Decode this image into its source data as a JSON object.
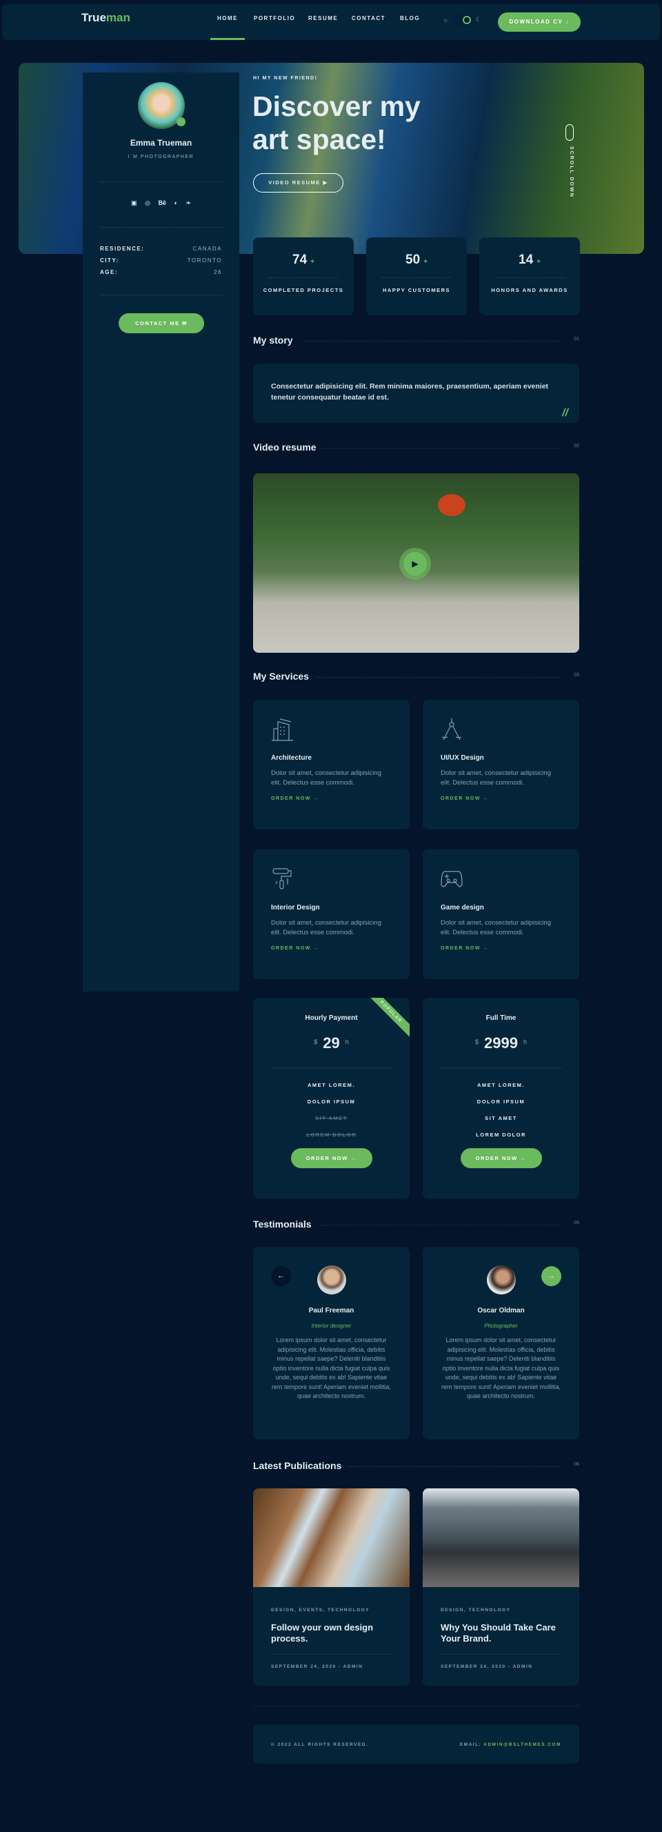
{
  "header": {
    "logo_a": "True",
    "logo_b": "man",
    "nav": [
      "Home",
      "Portfolio",
      "Resume",
      "Contact",
      "Blog"
    ],
    "download": "Download CV",
    "accent": "#6cba5e"
  },
  "hero": {
    "kicker": "Hi my new friend!",
    "title_1": "Discover my",
    "title_2": "art space!",
    "video_btn": "Video resume",
    "scroll": "Scroll down"
  },
  "profile": {
    "name": "Emma Trueman",
    "role": "I`m photographer",
    "social": [
      "linkedin-icon",
      "dribbble-icon",
      "behance-icon",
      "github-icon",
      "twitter-icon"
    ],
    "info": [
      {
        "k": "Residence:",
        "v": "Canada"
      },
      {
        "k": "City:",
        "v": "Toronto"
      },
      {
        "k": "Age:",
        "v": "26"
      }
    ],
    "contact": "Contact me"
  },
  "stats": [
    {
      "v": "74",
      "l": "Completed projects"
    },
    {
      "v": "50",
      "l": "Happy customers"
    },
    {
      "v": "14",
      "l": "Honors and awards"
    }
  ],
  "sections": [
    {
      "t": "My story",
      "n": "01"
    },
    {
      "t": "Video resume",
      "n": "02"
    },
    {
      "t": "My Services",
      "n": "03"
    },
    {
      "t": "Testimonials",
      "n": "05"
    },
    {
      "t": "Latest Publications",
      "n": "06"
    }
  ],
  "story": "Consectetur adipisicing elit. Rem minima maiores, praesentium, aperiam eveniet tenetur consequatur beatae id est.",
  "services": [
    {
      "t": "Architecture",
      "d": "Dolor sit amet, consectetur adipisicing elit. Delectus esse commodi.",
      "o": "Order now"
    },
    {
      "t": "UI/UX Design",
      "d": "Dolor sit amet, consectetur adipisicing elit. Delectus esse commodi.",
      "o": "Order now"
    },
    {
      "t": "Interior Design",
      "d": "Dolor sit amet, consectetur adipisicing elit. Delectus esse commodi.",
      "o": "Order now"
    },
    {
      "t": "Game design",
      "d": "Dolor sit amet, consectetur adipisicing elit. Delectus esse commodi.",
      "o": "Order now"
    }
  ],
  "pricing": [
    {
      "t": "Hourly Payment",
      "cur": "$",
      "amt": "29",
      "unit": "h",
      "badge": "Popular",
      "f": [
        "Amet lorem.",
        "Dolor ipsum",
        "Sit amet",
        "Lorem dolor"
      ],
      "btn": "Order now"
    },
    {
      "t": "Full Time",
      "cur": "$",
      "amt": "2999",
      "unit": "h",
      "f": [
        "Amet lorem.",
        "Dolor ipsum",
        "Sit amet",
        "Lorem dolor"
      ],
      "btn": "Order now"
    }
  ],
  "testimonials": [
    {
      "n": "Paul Freeman",
      "r": "Interior designer",
      "q": "Lorem ipsum dolor sit amet, consectetur adipisicing elit. Molestias officia, debitis minus repellat saepe? Deleniti blanditiis optio inventore nulla dicta fugiat culpa quis unde, sequi debitis ex ab! Sapiente vitae rem tempore sunt! Aperiam eveniet mollitia, quae architecto nostrum."
    },
    {
      "n": "Oscar Oldman",
      "r": "Photographer",
      "q": "Lorem ipsum dolor sit amet, consectetur adipisicing elit. Molestias officia, debitis minus repellat saepe? Deleniti blanditiis optio inventore nulla dicta fugiat culpa quis unde, sequi debitis ex ab! Sapiente vitae rem tempore sunt! Aperiam eveniet mollitia, quae architecto nostrum."
    }
  ],
  "publications": [
    {
      "cat": "Design, Events, Technology",
      "t": "Follow your own design process.",
      "d": "September 24, 2020 - Admin"
    },
    {
      "cat": "Design, Technology",
      "t": "Why You Should Take Care Your Brand.",
      "d": "September 24, 2020 - Admin"
    }
  ],
  "footer": {
    "copy": "© 2022 All Rights Reserved.",
    "email_label": "Email:",
    "email": "admin@bslthemes.com"
  }
}
